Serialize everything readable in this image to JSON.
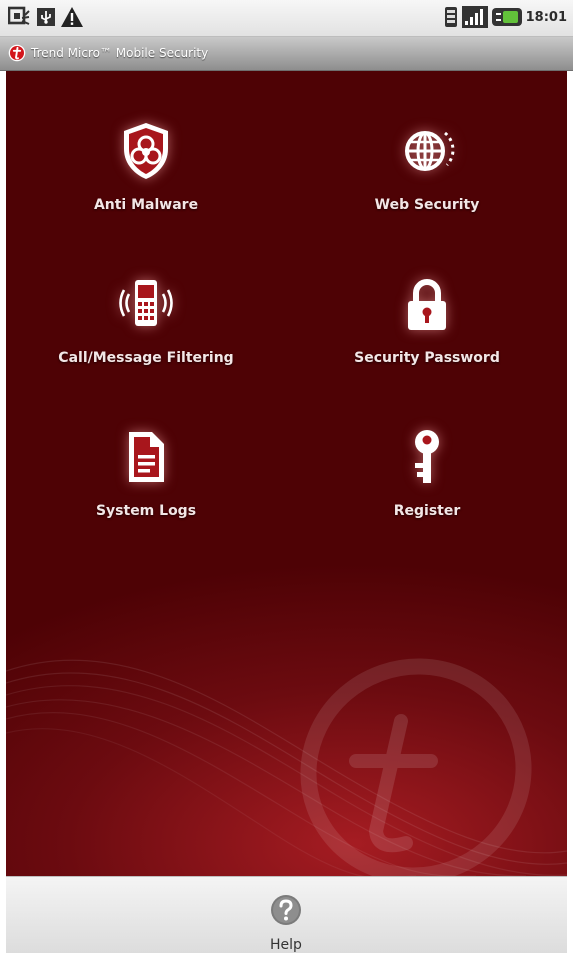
{
  "status_bar": {
    "time": "18:01",
    "icons": [
      "usb-debug-icon",
      "usb-icon",
      "warning-icon",
      "vibrate-icon",
      "signal-icon",
      "battery-icon"
    ]
  },
  "app": {
    "title": "Trend Micro™ Mobile Security",
    "logo": "trend-micro-logo",
    "accent_color": "#d3161c"
  },
  "tiles": [
    {
      "label": "Anti Malware",
      "icon": "biohazard-shield-icon"
    },
    {
      "label": "Web Security",
      "icon": "globe-icon"
    },
    {
      "label": "Call/Message Filtering",
      "icon": "phone-icon"
    },
    {
      "label": "Security Password",
      "icon": "padlock-icon"
    },
    {
      "label": "System Logs",
      "icon": "document-icon"
    },
    {
      "label": "Register",
      "icon": "key-icon"
    }
  ],
  "bottom_bar": {
    "help_label": "Help",
    "help_icon": "help-icon"
  },
  "colors": {
    "background_dark": "#4e0205",
    "background_highlight": "#a51c22",
    "label_text": "#f3e6e6"
  }
}
